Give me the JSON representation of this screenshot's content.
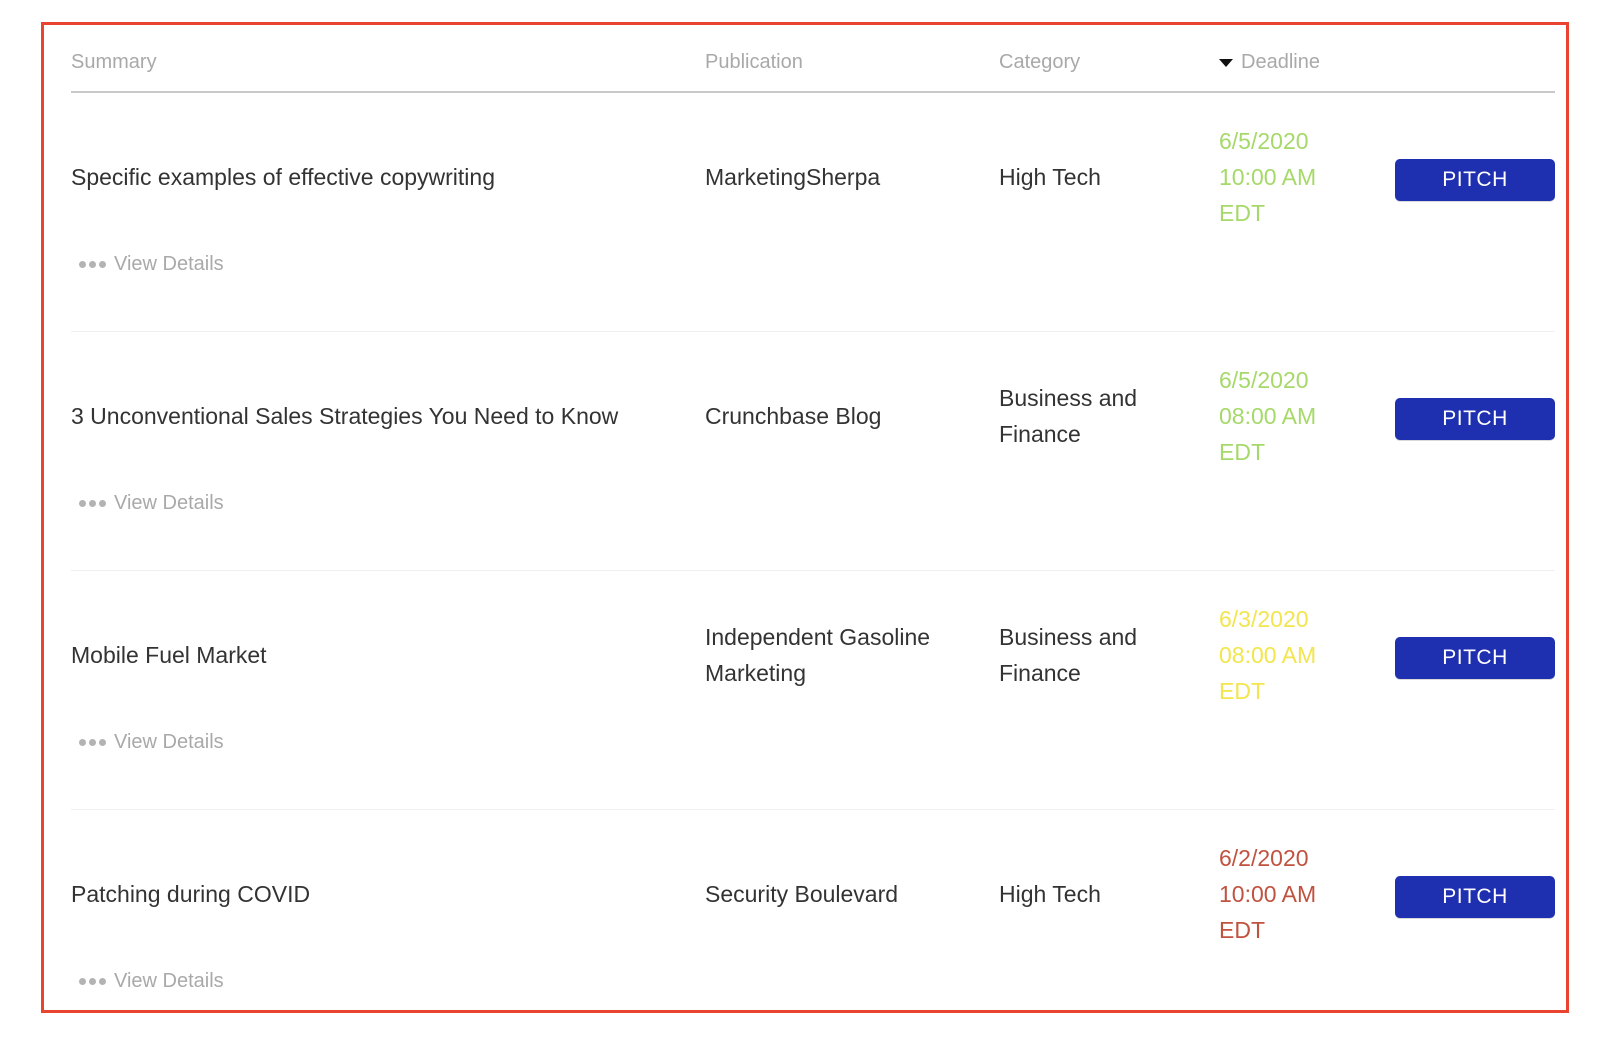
{
  "table": {
    "headers": {
      "summary": "Summary",
      "publication": "Publication",
      "category": "Category",
      "deadline": "Deadline"
    },
    "rows": [
      {
        "summary": "Specific examples of effective copywriting",
        "publication": "MarketingSherpa",
        "category": "High Tech",
        "deadline_date": "6/5/2020",
        "deadline_time": "10:00 AM",
        "deadline_tz": "EDT",
        "deadline_color": "#a6d96a",
        "action_label": "PITCH",
        "details_label": "View Details"
      },
      {
        "summary": "3 Unconventional Sales Strategies You Need to Know",
        "publication": "Crunchbase Blog",
        "category": "Business and Finance",
        "deadline_date": "6/5/2020",
        "deadline_time": "08:00 AM",
        "deadline_tz": "EDT",
        "deadline_color": "#a6d96a",
        "action_label": "PITCH",
        "details_label": "View Details"
      },
      {
        "summary": "Mobile Fuel Market",
        "publication": "Independent Gasoline Marketing",
        "category": "Business and Finance",
        "deadline_date": "6/3/2020",
        "deadline_time": "08:00 AM",
        "deadline_tz": "EDT",
        "deadline_color": "#f2e54d",
        "action_label": "PITCH",
        "details_label": "View Details"
      },
      {
        "summary": "Patching during COVID",
        "publication": "Security Boulevard",
        "category": "High Tech",
        "deadline_date": "6/2/2020",
        "deadline_time": "10:00 AM",
        "deadline_tz": "EDT",
        "deadline_color": "#c0533f",
        "action_label": "PITCH",
        "details_label": "View Details"
      }
    ]
  },
  "colors": {
    "frame_border": "#e8442f",
    "pitch_button": "#1e2fb0",
    "header_text": "#a9a9a9",
    "body_text": "#333333"
  },
  "icons": {
    "sort": "caret-down-icon",
    "details": "ellipsis-icon"
  }
}
